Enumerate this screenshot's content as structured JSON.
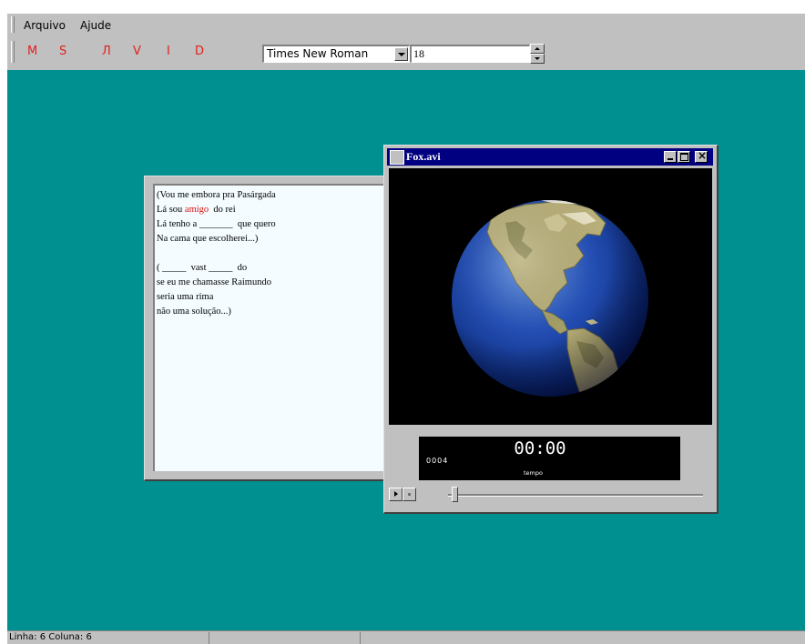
{
  "menubar": {
    "items": [
      "Arquivo",
      "Ajude"
    ]
  },
  "toolbar": {
    "format_buttons": [
      "M",
      "S",
      "Л",
      "V",
      "I",
      "D"
    ],
    "font_name": "Times New Roman",
    "font_size": "18"
  },
  "document": {
    "stanza1": {
      "line1": "(Vou me embora pra Pasárgada",
      "line2_before": "Lá sou ",
      "line2_highlight": "amigo",
      "line2_after": "  do rei",
      "line3": "Lá tenho a _______  que quero",
      "line4": "Na cama que escolherei...)"
    },
    "stanza2": {
      "line1": "( _____  vast _____  do",
      "line2": "se eu me chamasse Raimundo",
      "line3": "seria uma rima",
      "line4": "não uma solução...)"
    }
  },
  "player": {
    "title": "Fox.avi",
    "frame_counter": "0004",
    "time_display": "00:00",
    "time_label": "tempo",
    "position": 0.0
  },
  "statusbar": {
    "position": "Linha: 6  Coluna: 6"
  },
  "colors": {
    "workspace": "#009090",
    "titlebar": "#000080",
    "format_buttons": "#e02020",
    "highlight_word": "#e01010"
  }
}
